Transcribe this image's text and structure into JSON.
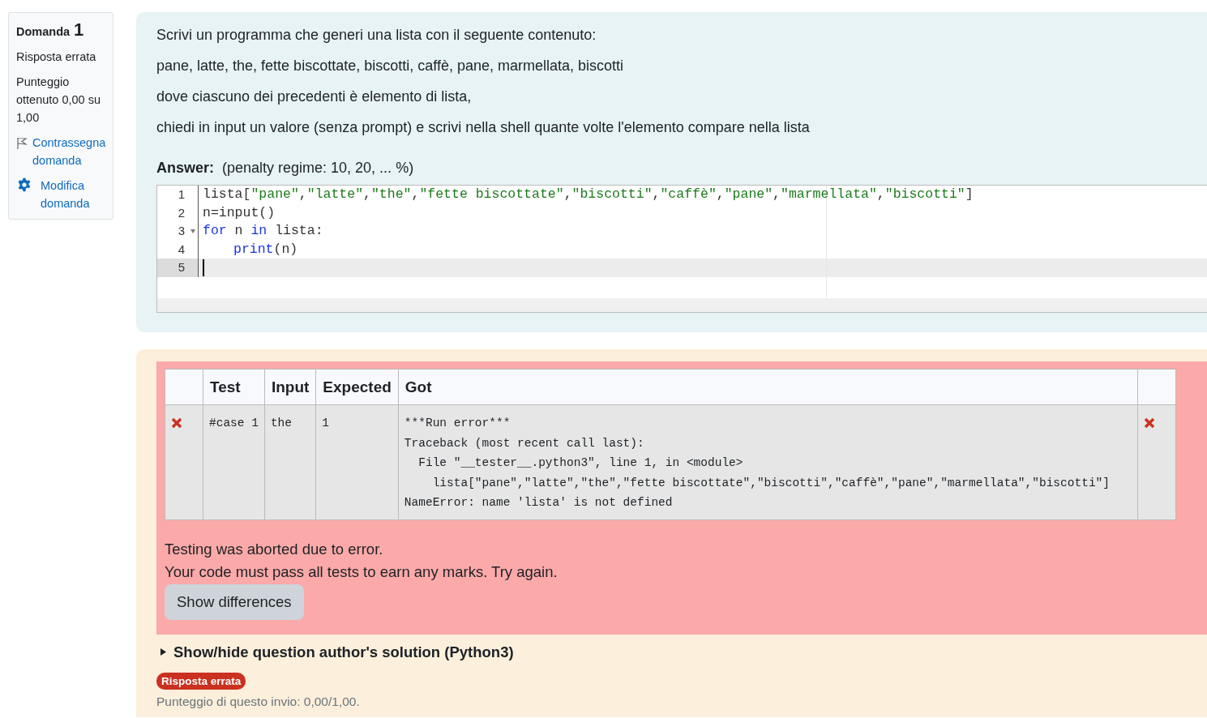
{
  "sidebar": {
    "title": "Domanda",
    "number": "1",
    "status": "Risposta errata",
    "grade": "Punteggio ottenuto 0,00 su 1,00",
    "flag": "Contrassegna domanda",
    "edit": "Modifica domanda"
  },
  "question": {
    "paragraphs": [
      "Scrivi un programma che generi una lista con il seguente contenuto:",
      "pane, latte, the, fette biscottate, biscotti, caffè, pane, marmellata, biscotti",
      "dove ciascuno dei precedenti è elemento di lista,",
      "chiedi in input un valore (senza prompt) e scrivi nella shell quante volte l'elemento compare nella lista"
    ],
    "answer_label": "Answer:",
    "penalty": "(penalty regime: 10, 20, ... %)",
    "editor": {
      "lines": [
        {
          "number": "1",
          "fold": false,
          "current": false,
          "indent": false,
          "tokens": [
            {
              "kind": "plain",
              "text": "lista["
            },
            {
              "kind": "string",
              "text": "\"pane\""
            },
            {
              "kind": "plain",
              "text": ","
            },
            {
              "kind": "string",
              "text": "\"latte\""
            },
            {
              "kind": "plain",
              "text": ","
            },
            {
              "kind": "string",
              "text": "\"the\""
            },
            {
              "kind": "plain",
              "text": ","
            },
            {
              "kind": "string",
              "text": "\"fette biscottate\""
            },
            {
              "kind": "plain",
              "text": ","
            },
            {
              "kind": "string",
              "text": "\"biscotti\""
            },
            {
              "kind": "plain",
              "text": ","
            },
            {
              "kind": "string",
              "text": "\"caffè\""
            },
            {
              "kind": "plain",
              "text": ","
            },
            {
              "kind": "string",
              "text": "\"pane\""
            },
            {
              "kind": "plain",
              "text": ","
            },
            {
              "kind": "string",
              "text": "\"marmellata\""
            },
            {
              "kind": "plain",
              "text": ","
            },
            {
              "kind": "string",
              "text": "\"biscotti\""
            },
            {
              "kind": "plain",
              "text": "]"
            }
          ]
        },
        {
          "number": "2",
          "fold": false,
          "current": false,
          "indent": false,
          "tokens": [
            {
              "kind": "plain",
              "text": "n=input()"
            }
          ]
        },
        {
          "number": "3",
          "fold": true,
          "current": false,
          "indent": false,
          "tokens": [
            {
              "kind": "keyword",
              "text": "for"
            },
            {
              "kind": "plain",
              "text": " n "
            },
            {
              "kind": "keyword",
              "text": "in"
            },
            {
              "kind": "plain",
              "text": " lista:"
            }
          ]
        },
        {
          "number": "4",
          "fold": false,
          "current": false,
          "indent": true,
          "tokens": [
            {
              "kind": "keyword",
              "text": "print"
            },
            {
              "kind": "plain",
              "text": "(n)"
            }
          ]
        },
        {
          "number": "5",
          "fold": false,
          "current": true,
          "indent": false
        }
      ]
    }
  },
  "results": {
    "columns": [
      "Test",
      "Input",
      "Expected",
      "Got"
    ],
    "rows": [
      {
        "passed": false,
        "test": "#case 1",
        "input": "the",
        "expected": "1",
        "got": "***Run error***\nTraceback (most recent call last):\n  File \"__tester__.python3\", line 1, in <module>\n    lista[\"pane\",\"latte\",\"the\",\"fette biscottate\",\"biscotti\",\"caffè\",\"pane\",\"marmellata\",\"biscotti\"]\nNameError: name 'lista' is not defined"
      }
    ],
    "messages": [
      "Testing was aborted due to error.",
      "Your code must pass all tests to earn any marks. Try again."
    ],
    "button": "Show differences"
  },
  "solution_toggle": "Show/hide question author's solution (Python3)",
  "badge": "Risposta errata",
  "score": "Punteggio di questo invio: 0,00/1,00."
}
